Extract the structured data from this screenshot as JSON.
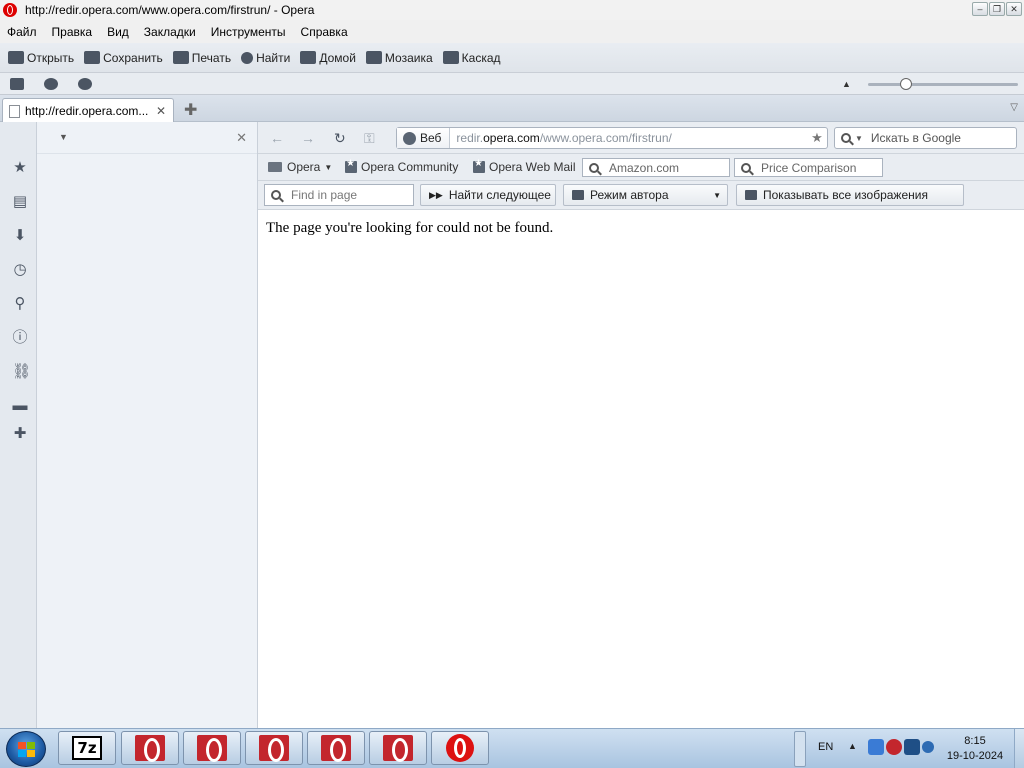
{
  "window": {
    "title": "http://redir.opera.com/www.opera.com/firstrun/ - Opera",
    "controls": [
      "minimize",
      "restore",
      "close"
    ]
  },
  "menu": [
    "Файл",
    "Правка",
    "Вид",
    "Закладки",
    "Инструменты",
    "Справка"
  ],
  "toolbar": [
    {
      "label": "Открыть",
      "icon": "folder-icon"
    },
    {
      "label": "Сохранить",
      "icon": "save-icon"
    },
    {
      "label": "Печать",
      "icon": "print-icon"
    },
    {
      "label": "Найти",
      "icon": "search-icon"
    },
    {
      "label": "Домой",
      "icon": "home-icon"
    },
    {
      "label": "Мозаика",
      "icon": "tile-icon"
    },
    {
      "label": "Каскад",
      "icon": "cascade-icon"
    }
  ],
  "tabs": [
    {
      "label": "http://redir.opera.com...",
      "active": true
    }
  ],
  "address": {
    "mode": "Веб",
    "url_prefix": "redir.",
    "url_domain": "opera.com",
    "url_path": "/www.opera.com/firstrun/",
    "search_placeholder": "Искать в Google"
  },
  "bookmarks": {
    "items": [
      "Opera",
      "Opera Community",
      "Opera Web Mail"
    ],
    "fields": [
      "Amazon.com",
      "Price Comparison"
    ]
  },
  "findbar": {
    "placeholder": "Find in page",
    "find_next": "Найти следующее",
    "author_mode": "Режим автора",
    "show_images": "Показывать все изображения"
  },
  "content": {
    "message": "The page you're looking for could not be found."
  },
  "zoom": {
    "level": 0.25
  },
  "taskbar": {
    "lang": "EN",
    "time": "8:15",
    "date": "19-10-2024",
    "app_7z": "7z"
  },
  "colors": {
    "opera_red": "#c3262d",
    "chrome_bg": "#e9edf2",
    "taskbar": "#a9c4e0"
  }
}
